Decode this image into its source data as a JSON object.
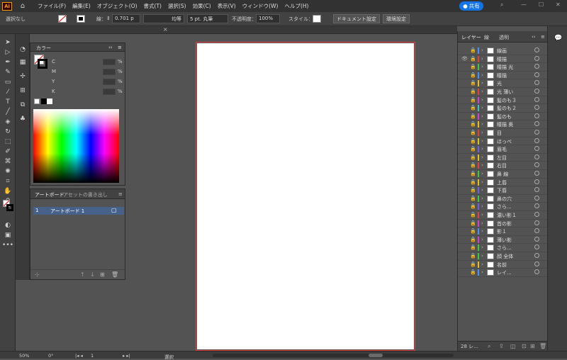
{
  "app": {
    "logo": "Ai",
    "share_label": "共有"
  },
  "menu": [
    "ファイル(F)",
    "編集(E)",
    "オブジェクト(O)",
    "書式(T)",
    "選択(S)",
    "効果(C)",
    "表示(V)",
    "ウィンドウ(W)",
    "ヘルプ(H)"
  ],
  "control": {
    "selection": "選択なし",
    "stroke_label": "線：",
    "stroke_value": "0.701 p",
    "profile": "均等",
    "brush": "5 pt. 丸筆",
    "opacity_label": "不透明度：",
    "opacity_value": "100%",
    "style_label": "スタイル：",
    "doc_settings": "ドキュメント設定",
    "prefs": "環境設定"
  },
  "color_panel": {
    "title": "カラー",
    "channels": [
      {
        "label": "C",
        "unit": "%"
      },
      {
        "label": "M",
        "unit": "%"
      },
      {
        "label": "Y",
        "unit": "%"
      },
      {
        "label": "K",
        "unit": "%"
      }
    ]
  },
  "artboard_panel": {
    "tab_artboards": "アートボード",
    "tab_assets": "アセットの書き出し",
    "rows": [
      {
        "index": "1",
        "name": "アートボード 1"
      }
    ]
  },
  "layers_panel": {
    "tabs": [
      "レイヤー",
      "線",
      "透明"
    ],
    "count_label": "28 レ...",
    "layers": [
      {
        "name": "線画",
        "color": "#4f8ef7"
      },
      {
        "name": "瞳描",
        "color": "#e04040"
      },
      {
        "name": "瞳描 光",
        "color": "#3cc93c"
      },
      {
        "name": "瞳描",
        "color": "#4f8ef7"
      },
      {
        "name": "光",
        "color": "#e0c020"
      },
      {
        "name": "光 薄い",
        "color": "#e04040"
      },
      {
        "name": "髪のも３",
        "color": "#d040d0"
      },
      {
        "name": "髪のも２",
        "color": "#40c0c0"
      },
      {
        "name": "髪のも",
        "color": "#d040d0"
      },
      {
        "name": "瞳描 奥",
        "color": "#e0c020"
      },
      {
        "name": "目",
        "color": "#e04040"
      },
      {
        "name": "ほっぺ",
        "color": "#e0c020"
      },
      {
        "name": "眉毛",
        "color": "#7060e0"
      },
      {
        "name": "左目",
        "color": "#e0c020"
      },
      {
        "name": "右目",
        "color": "#e04040"
      },
      {
        "name": "鼻 線",
        "color": "#3cc93c"
      },
      {
        "name": "上唇",
        "color": "#e0c020"
      },
      {
        "name": "下唇",
        "color": "#7060e0"
      },
      {
        "name": "鼻の穴",
        "color": "#3cc93c"
      },
      {
        "name": "さら...",
        "color": "#7060e0"
      },
      {
        "name": "濃い影１",
        "color": "#e04040"
      },
      {
        "name": "首の影",
        "color": "#d040d0"
      },
      {
        "name": "影１",
        "color": "#4f8ef7"
      },
      {
        "name": "薄い影",
        "color": "#d040d0"
      },
      {
        "name": "さら...",
        "color": "#3cc93c"
      },
      {
        "name": "顔 全体",
        "color": "#3cc93c"
      },
      {
        "name": "名前",
        "color": "#e0c020"
      },
      {
        "name": "レイ...",
        "color": "#4f8ef7"
      }
    ]
  },
  "status": {
    "zoom": "50%",
    "rotate": "0°",
    "page": "1",
    "tool": "選択"
  }
}
